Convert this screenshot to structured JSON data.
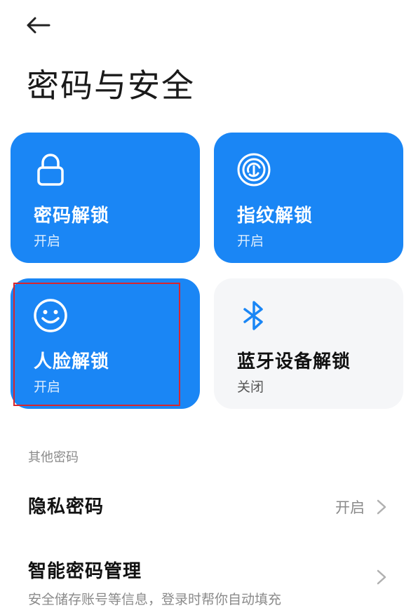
{
  "header": {
    "title": "密码与安全"
  },
  "cards": [
    {
      "name": "密码解锁",
      "state": "开启",
      "icon": "lock-icon",
      "enabled": true
    },
    {
      "name": "指纹解锁",
      "state": "开启",
      "icon": "fingerprint-icon",
      "enabled": true
    },
    {
      "name": "人脸解锁",
      "state": "开启",
      "icon": "face-icon",
      "enabled": true
    },
    {
      "name": "蓝牙设备解锁",
      "state": "关闭",
      "icon": "bluetooth-icon",
      "enabled": false
    }
  ],
  "colors": {
    "accent": "#1a86f5",
    "card_off": "#f5f6f8",
    "highlight": "#d8262d"
  },
  "other": {
    "section_label": "其他密码",
    "privacy": {
      "label": "隐私密码",
      "value": "开启"
    },
    "smart": {
      "label": "智能密码管理",
      "sub": "安全储存账号等信息，登录时帮你自动填充"
    }
  }
}
